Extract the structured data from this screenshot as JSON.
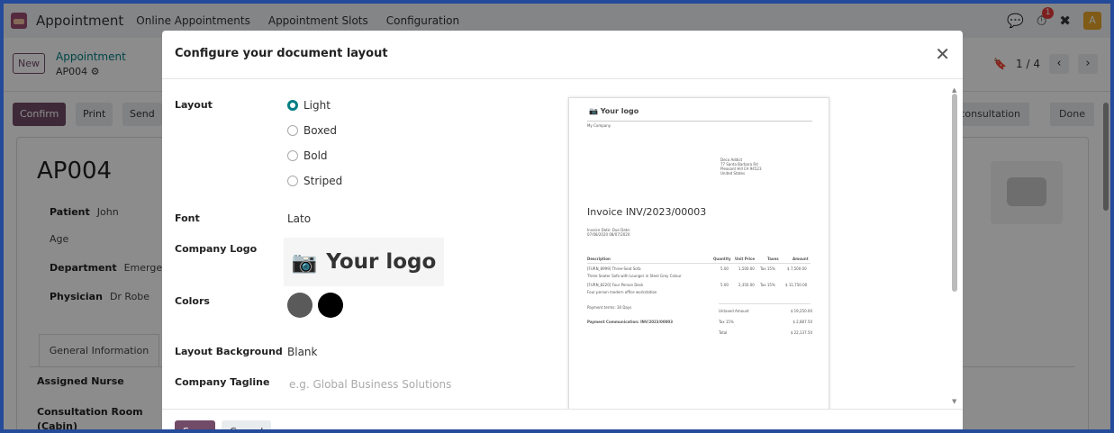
{
  "topbar": {
    "app_name": "Appointment",
    "menu": [
      "Online Appointments",
      "Appointment Slots",
      "Configuration"
    ],
    "notif_count": "1",
    "user_initial": "A"
  },
  "breadcrumb": {
    "new_label": "New",
    "parent": "Appointment",
    "record": "AP004"
  },
  "pager": {
    "text": "1 / 4"
  },
  "status": {
    "buttons": [
      "Confirm",
      "Print",
      "Send"
    ],
    "stages": [
      "consultation",
      "Done"
    ]
  },
  "record": {
    "title": "AP004",
    "fields": [
      {
        "label": "Patient",
        "value": "John"
      },
      {
        "label": "Age",
        "value": ""
      },
      {
        "label": "Department",
        "value": "Emerge"
      },
      {
        "label": "Physician",
        "value": "Dr Robe"
      }
    ],
    "tab": "General Information",
    "lower_fields": [
      "Assigned Nurse",
      "Consultation Room",
      "(Cabin)"
    ]
  },
  "modal": {
    "title": "Configure your document layout",
    "labels": {
      "layout": "Layout",
      "font": "Font",
      "company_logo": "Company Logo",
      "colors": "Colors",
      "layout_background": "Layout Background",
      "company_tagline": "Company Tagline"
    },
    "layout_options": [
      "Light",
      "Boxed",
      "Bold",
      "Striped"
    ],
    "selected_layout": "Light",
    "font_value": "Lato",
    "logo_text": "Your logo",
    "colors": [
      "#5a5a5a",
      "#000000"
    ],
    "background_value": "Blank",
    "tagline_placeholder": "e.g. Global Business Solutions",
    "save_label": "Save",
    "cancel_label": "Cancel"
  },
  "preview": {
    "logo": "Your logo",
    "company": "My Company",
    "address": [
      "Deco Addict",
      "77 Santa Barbara Rd",
      "Pleasant Hill CA 94523",
      "United States"
    ],
    "invoice_title": "Invoice INV/2023/00003",
    "invoice_date_label": "Invoice Date:",
    "invoice_date": "07/08/2020",
    "due_date_label": "Due Date:",
    "due_date": "08/07/2020",
    "columns": [
      "Description",
      "Quantity",
      "Unit Price",
      "Taxes",
      "Amount"
    ],
    "lines": [
      {
        "desc": "[FURN_8999] Three-Seat Sofa",
        "qty": "5.00",
        "price": "1,500.00",
        "tax": "Tax 15%",
        "amount": "$ 7,500.00"
      },
      {
        "desc": "Three Seater Sofa with Lounger in Steel Grey Colour",
        "qty": "",
        "price": "",
        "tax": "",
        "amount": ""
      },
      {
        "desc": "[FURN_8220] Four Person Desk",
        "qty": "5.00",
        "price": "2,350.00",
        "tax": "Tax 15%",
        "amount": "$ 11,750.00"
      },
      {
        "desc": "Four person modern office workstation",
        "qty": "",
        "price": "",
        "tax": "",
        "amount": ""
      }
    ],
    "payment_terms": "Payment terms: 30 Days",
    "payment_comm": "Payment Communication: INV/2023/00003",
    "totals": [
      {
        "label": "Untaxed Amount",
        "value": "$ 19,250.00"
      },
      {
        "label": "Tax 15%",
        "value": "$ 2,887.50"
      },
      {
        "label": "Total",
        "value": "$ 22,137.50"
      }
    ]
  }
}
